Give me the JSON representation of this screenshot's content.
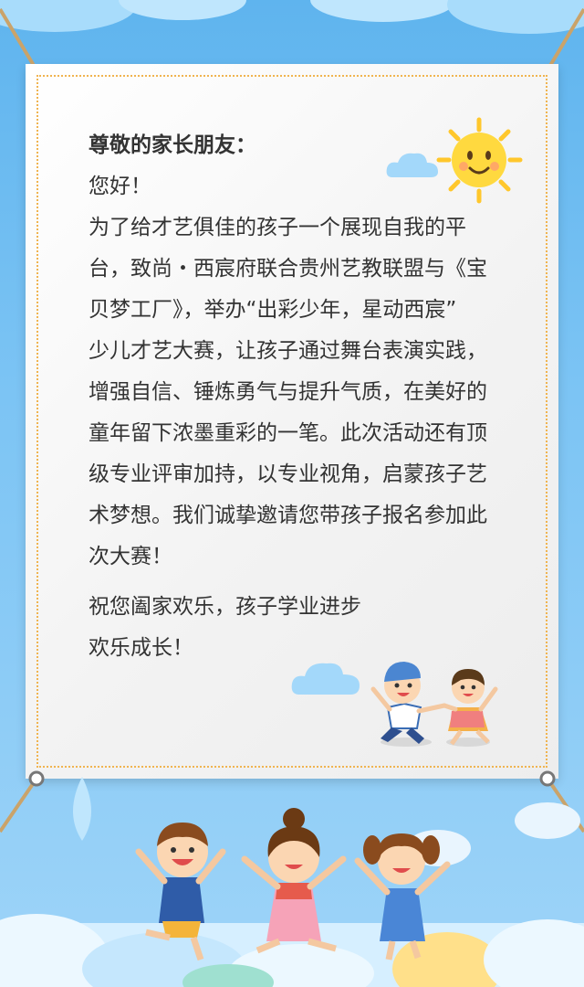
{
  "letter": {
    "salutation": "尊敬的家长朋友：",
    "greeting": "您好！",
    "body_lines": [
      "为了给才艺俱佳的孩子一个展现自我的平",
      "台，致尚・西宸府联合贵州艺教联盟与《宝",
      "贝梦工厂》，举办“出彩少年，星动西宸”",
      "少儿才艺大赛，让孩子通过舞台表演实践，",
      "增强自信、锤炼勇气与提升气质，在美好的",
      "童年留下浓墨重彩的一笔。此次活动还有顶",
      "级专业评审加持，以专业视角，启蒙孩子艺",
      "术梦想。我们诚挚邀请您带孩子报名参加此",
      "次大赛！"
    ],
    "closing_line1": "祝您阖家欢乐，孩子学业进步",
    "closing_line2": "欢乐成长！"
  },
  "colors": {
    "sky": "#6bbcf1",
    "border_dots": "#f0b450",
    "sun": "#ffd23f"
  }
}
